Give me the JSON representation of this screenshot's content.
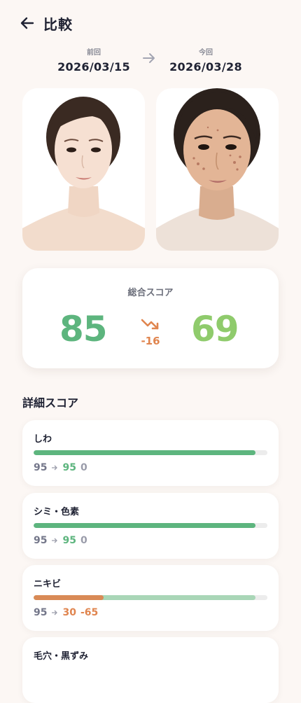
{
  "header": {
    "title": "比較",
    "back_icon": "arrow-left-icon"
  },
  "dates": {
    "previous_label": "前回",
    "previous_date": "2026/03/15",
    "current_label": "今回",
    "current_date": "2026/03/28",
    "arrow_icon": "arrow-right-icon"
  },
  "overall": {
    "label": "総合スコア",
    "previous": "85",
    "current": "69",
    "diff": "-16",
    "trend_icon": "trend-down-icon"
  },
  "details": {
    "title": "詳細スコア",
    "items": [
      {
        "name": "しわ",
        "previous": "95",
        "current": "95",
        "diff": "0",
        "prev_level": 0.95,
        "cur_level": 0.95
      },
      {
        "name": "シミ・色素",
        "previous": "95",
        "current": "95",
        "diff": "0",
        "prev_level": 0.95,
        "cur_level": 0.95
      },
      {
        "name": "ニキビ",
        "previous": "95",
        "current": "30",
        "diff": "-65",
        "prev_level": 0.95,
        "cur_level": 0.3
      },
      {
        "name": "毛穴・黒ずみ"
      }
    ]
  },
  "colors": {
    "background": "#fcf7f4",
    "green": "#5db57e",
    "light_green": "#8fcb6c",
    "orange": "#e0854f",
    "track": "#ececec"
  }
}
